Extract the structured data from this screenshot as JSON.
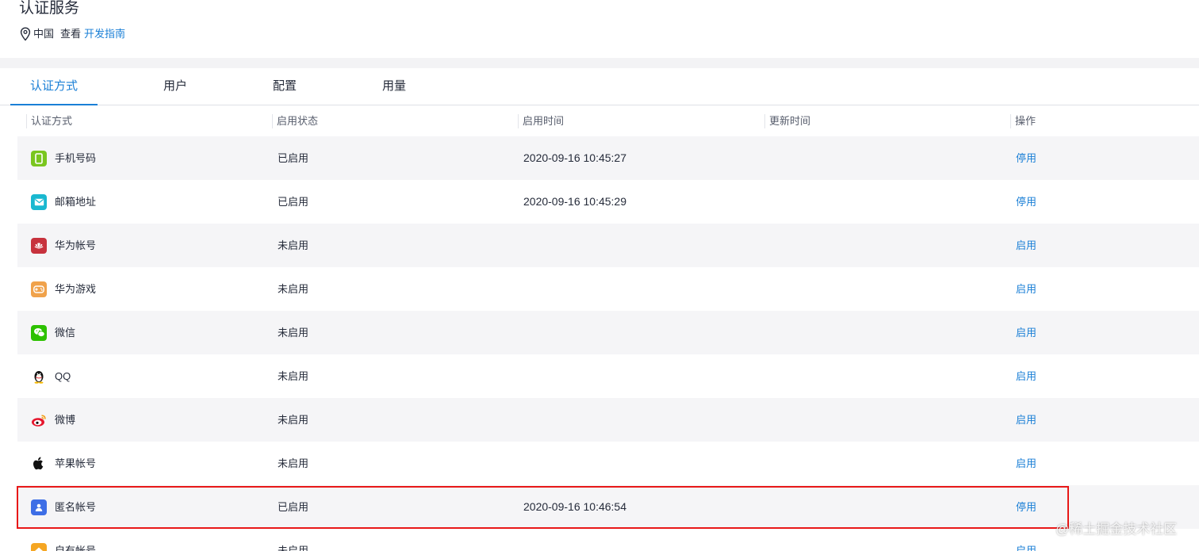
{
  "header": {
    "title": "认证服务",
    "region": "中国",
    "view_text": "查看",
    "guide_link": "开发指南"
  },
  "tabs": [
    {
      "label": "认证方式",
      "active": true
    },
    {
      "label": "用户",
      "active": false
    },
    {
      "label": "配置",
      "active": false
    },
    {
      "label": "用量",
      "active": false
    }
  ],
  "table": {
    "columns": [
      "认证方式",
      "启用状态",
      "启用时间",
      "更新时间",
      "操作"
    ],
    "rows": [
      {
        "name": "手机号码",
        "icon": "phone-icon",
        "status": "已启用",
        "enabled_time": "2020-09-16 10:45:27",
        "updated_time": "",
        "action": "停用"
      },
      {
        "name": "邮箱地址",
        "icon": "mail-icon",
        "status": "已启用",
        "enabled_time": "2020-09-16 10:45:29",
        "updated_time": "",
        "action": "停用"
      },
      {
        "name": "华为帐号",
        "icon": "huawei-icon",
        "status": "未启用",
        "enabled_time": "",
        "updated_time": "",
        "action": "启用"
      },
      {
        "name": "华为游戏",
        "icon": "gamepad-icon",
        "status": "未启用",
        "enabled_time": "",
        "updated_time": "",
        "action": "启用"
      },
      {
        "name": "微信",
        "icon": "wechat-icon",
        "status": "未启用",
        "enabled_time": "",
        "updated_time": "",
        "action": "启用"
      },
      {
        "name": "QQ",
        "icon": "qq-icon",
        "status": "未启用",
        "enabled_time": "",
        "updated_time": "",
        "action": "启用"
      },
      {
        "name": "微博",
        "icon": "weibo-icon",
        "status": "未启用",
        "enabled_time": "",
        "updated_time": "",
        "action": "启用"
      },
      {
        "name": "苹果帐号",
        "icon": "apple-icon",
        "status": "未启用",
        "enabled_time": "",
        "updated_time": "",
        "action": "启用"
      },
      {
        "name": "匿名帐号",
        "icon": "anonymous-user-icon",
        "status": "已启用",
        "enabled_time": "2020-09-16 10:46:54",
        "updated_time": "",
        "action": "停用"
      },
      {
        "name": "自有帐号",
        "icon": "own-account-icon",
        "status": "未启用",
        "enabled_time": "",
        "updated_time": "",
        "action": "启用"
      }
    ]
  },
  "colors": {
    "accent": "#1a7fd6",
    "highlight_border": "#e81818",
    "row_shade": "#f5f5f7"
  },
  "watermark": "@稀土掘金技术社区"
}
